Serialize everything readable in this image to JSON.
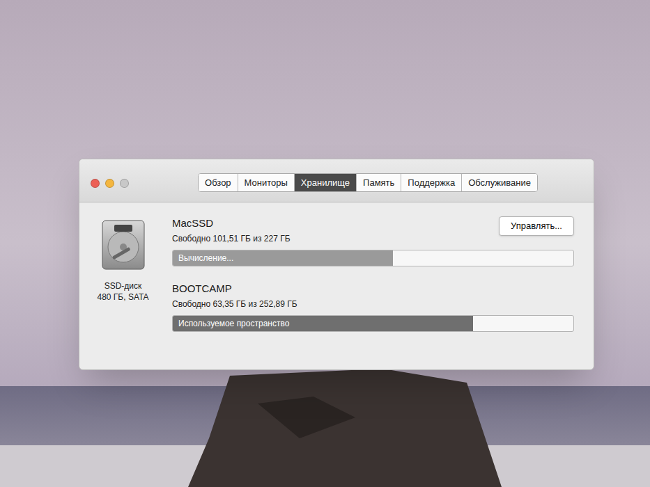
{
  "window": {
    "traffic_lights": [
      {
        "name": "close",
        "color": "#ec5f55",
        "disabled": false
      },
      {
        "name": "minimize",
        "color": "#f4b63f",
        "disabled": false
      },
      {
        "name": "zoom",
        "color": "#c8c8c8",
        "disabled": true
      }
    ]
  },
  "tabs": [
    {
      "label": "Обзор",
      "selected": false
    },
    {
      "label": "Мониторы",
      "selected": false
    },
    {
      "label": "Хранилище",
      "selected": true
    },
    {
      "label": "Память",
      "selected": false
    },
    {
      "label": "Поддержка",
      "selected": false
    },
    {
      "label": "Обслуживание",
      "selected": false
    }
  ],
  "disk": {
    "type": "SSD-диск",
    "size": "480 ГБ, SATA"
  },
  "manage_button": "Управлять...",
  "volumes": [
    {
      "name": "MacSSD",
      "free": "Свободно 101,51 ГБ из 227 ГБ",
      "bar_label": "Вычисление...",
      "level": 0.55,
      "color": "#9a9a9a"
    },
    {
      "name": "BOOTCAMP",
      "free": "Свободно 63,35 ГБ из 252,89 ГБ",
      "bar_label": "Используемое пространство",
      "level": 0.75,
      "color": "#6f6f6f"
    }
  ]
}
